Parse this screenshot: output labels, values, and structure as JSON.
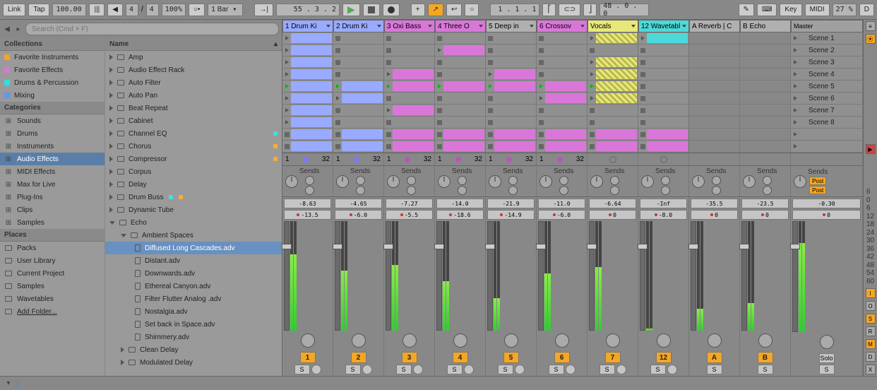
{
  "topbar": {
    "link": "Link",
    "tap": "Tap",
    "tempo": "100.00",
    "sig_a": "4",
    "sig_b": "4",
    "zoom": "100%",
    "quant": "1 Bar",
    "barpos": "55 .  3 .  2",
    "loop_pos": "1 .  1 .  1",
    "loop_len": "48 .  0 .  0",
    "key": "Key",
    "midi": "MIDI",
    "pct": "27 %",
    "d": "D"
  },
  "search": {
    "placeholder": "Search (Cmd + F)"
  },
  "browser": {
    "collections_header": "Collections",
    "name_header": "Name",
    "collections": [
      {
        "label": "Favorite Instruments",
        "color": "#f5a623"
      },
      {
        "label": "Favorite Effects",
        "color": "#d977d9"
      },
      {
        "label": "Drums & Percussion",
        "color": "#3dd"
      },
      {
        "label": "Mixing",
        "color": "#59f"
      }
    ],
    "categories_header": "Categories",
    "categories": [
      {
        "label": "Sounds"
      },
      {
        "label": "Drums"
      },
      {
        "label": "Instruments"
      },
      {
        "label": "Audio Effects",
        "sel": true
      },
      {
        "label": "MIDI Effects"
      },
      {
        "label": "Max for Live"
      },
      {
        "label": "Plug-Ins"
      },
      {
        "label": "Clips"
      },
      {
        "label": "Samples"
      }
    ],
    "places_header": "Places",
    "places": [
      {
        "label": "Packs"
      },
      {
        "label": "User Library"
      },
      {
        "label": "Current Project"
      },
      {
        "label": "Samples"
      },
      {
        "label": "Wavetables"
      },
      {
        "label": "Add Folder...",
        "und": true
      }
    ],
    "devices": [
      {
        "label": "Amp"
      },
      {
        "label": "Audio Effect Rack"
      },
      {
        "label": "Auto Filter"
      },
      {
        "label": "Auto Pan"
      },
      {
        "label": "Beat Repeat"
      },
      {
        "label": "Cabinet"
      },
      {
        "label": "Channel EQ",
        "tag": "#4dd"
      },
      {
        "label": "Chorus",
        "tag": "#fa3"
      },
      {
        "label": "Compressor",
        "tag": "#fa3"
      },
      {
        "label": "Corpus"
      },
      {
        "label": "Delay"
      },
      {
        "label": "Drum Buss",
        "tags": [
          "#4dd",
          "#fa3"
        ]
      },
      {
        "label": "Dynamic Tube"
      },
      {
        "label": "Echo",
        "open": true
      }
    ],
    "echo_folder": "Ambient Spaces",
    "presets": [
      {
        "label": "Diffused Long Cascades.adv",
        "sel": true
      },
      {
        "label": "Distant.adv"
      },
      {
        "label": "Downwards.adv"
      },
      {
        "label": "Ethereal Canyon.adv"
      },
      {
        "label": "Filter Flutter Analog .adv"
      },
      {
        "label": "Nostalgia.adv"
      },
      {
        "label": "Set back in Space.adv"
      },
      {
        "label": "Shimmery.adv"
      }
    ],
    "after": [
      {
        "label": "Clean Delay"
      },
      {
        "label": "Modulated Delay"
      }
    ]
  },
  "tracks": [
    {
      "name": "1 Drum Ki",
      "cls": "th-blue",
      "clips": [
        1,
        1,
        1,
        1,
        1,
        1,
        1,
        1
      ],
      "play": 4,
      "info_l": "1",
      "info_r": "32",
      "ball": "blue",
      "peak": "-8.63",
      "gain": "-13.5",
      "num": "1",
      "mh": 70
    },
    {
      "name": "2 Drum Ki",
      "cls": "th-blue",
      "clips": [
        0,
        0,
        0,
        0,
        1,
        1,
        0,
        0
      ],
      "play": 4,
      "info_l": "1",
      "info_r": "32",
      "ball": "blue",
      "peak": "-4.65",
      "gain": "-6.0",
      "num": "2",
      "mh": 55
    },
    {
      "name": "3 Oxi Bass",
      "cls": "th-pink",
      "clips": [
        0,
        0,
        0,
        1,
        1,
        0,
        1,
        0
      ],
      "play": 4,
      "info_l": "1",
      "info_r": "32",
      "ball": "purple",
      "peak": "-7.27",
      "gain": "-5.5",
      "num": "3",
      "mh": 60
    },
    {
      "name": "4 Three O",
      "cls": "th-pink",
      "clips": [
        0,
        1,
        0,
        0,
        1,
        0,
        0,
        0
      ],
      "play": 4,
      "info_l": "1",
      "info_r": "32",
      "ball": "purple",
      "peak": "-14.0",
      "gain": "-18.6",
      "num": "4",
      "mh": 45
    },
    {
      "name": "5 Deep in",
      "cls": "th-grey",
      "clips": [
        0,
        0,
        0,
        1,
        1,
        0,
        0,
        0
      ],
      "play": 4,
      "info_l": "1",
      "info_r": "32",
      "ball": "purple",
      "peak": "-21.9",
      "gain": "-14.9",
      "num": "5",
      "mh": 30
    },
    {
      "name": "6 Crossov",
      "cls": "th-pink",
      "clips": [
        0,
        0,
        0,
        0,
        1,
        1,
        0,
        0
      ],
      "play": 4,
      "info_l": "1",
      "info_r": "32",
      "ball": "purple",
      "peak": "-11.0",
      "gain": "-6.0",
      "num": "6",
      "mh": 52
    },
    {
      "name": "Vocals",
      "cls": "th-yellow",
      "clips": [
        2,
        0,
        2,
        2,
        2,
        2,
        0,
        0
      ],
      "play": 4,
      "info_l": "",
      "info_r": "",
      "ball": "",
      "peak": "-6.64",
      "gain": "0",
      "num": "7",
      "mh": 58,
      "noball": true
    },
    {
      "name": "12 Wavetabl",
      "cls": "th-cyan",
      "clips": [
        3,
        0,
        0,
        0,
        0,
        0,
        0,
        0
      ],
      "play": -1,
      "info_l": "",
      "info_r": "",
      "ball": "",
      "peak": "-Inf",
      "gain": "-8.0",
      "num": "12",
      "mh": 2,
      "noball": true
    },
    {
      "name": "A Reverb | C",
      "cls": "th-grey",
      "return": true,
      "peak": "-35.5",
      "gain": "0",
      "num": "A",
      "mh": 20
    },
    {
      "name": "B Echo",
      "cls": "th-grey",
      "return": true,
      "peak": "-23.5",
      "gain": "0",
      "num": "B",
      "mh": 25
    }
  ],
  "master": {
    "name": "Master",
    "peak": "-0.30",
    "gain": "0",
    "scenes": [
      "Scene 1",
      "Scene 2",
      "Scene 3",
      "Scene 4",
      "Scene 5",
      "Scene 6",
      "Scene 7",
      "Scene 8"
    ],
    "solo": "Solo"
  },
  "sends_label": "Sends",
  "s_label": "S",
  "post": "Post",
  "db_scale": [
    "6",
    "0",
    "6",
    "12",
    "18",
    "24",
    "30",
    "36",
    "42",
    "48",
    "54",
    "60"
  ]
}
